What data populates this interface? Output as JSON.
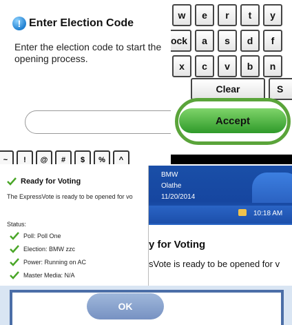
{
  "enter": {
    "title": "Enter Election Code",
    "instruction": "Enter the election code to start the opening process.",
    "code_value": "",
    "symbols": [
      "~",
      "!",
      "@",
      "#",
      "$",
      "%",
      "^"
    ]
  },
  "keyboard": {
    "row1": [
      "w",
      "e",
      "r",
      "t",
      "y"
    ],
    "row2": [
      "ock",
      "a",
      "s",
      "d",
      "f"
    ],
    "row3": [
      "x",
      "c",
      "v",
      "b",
      "n"
    ],
    "clear_label": "Clear",
    "s_label": "S",
    "accept_label": "Accept"
  },
  "window": {
    "line1": "BMW",
    "line2": "Olathe",
    "date": "11/20/2014",
    "time": "10:18 AM",
    "title_fragment": "y for Voting",
    "message_fragment": "sVote is ready to be opened for v"
  },
  "ready": {
    "title": "Ready for Voting",
    "description": "The ExpressVote is ready to be opened for vo",
    "status_label": "Status:",
    "items": [
      "Poll: Poll One",
      "Election: BMW zzc",
      "Power: Running on AC",
      "Master Media: N/A"
    ],
    "check_color": "#4aa628"
  },
  "ok": {
    "label": "OK"
  }
}
